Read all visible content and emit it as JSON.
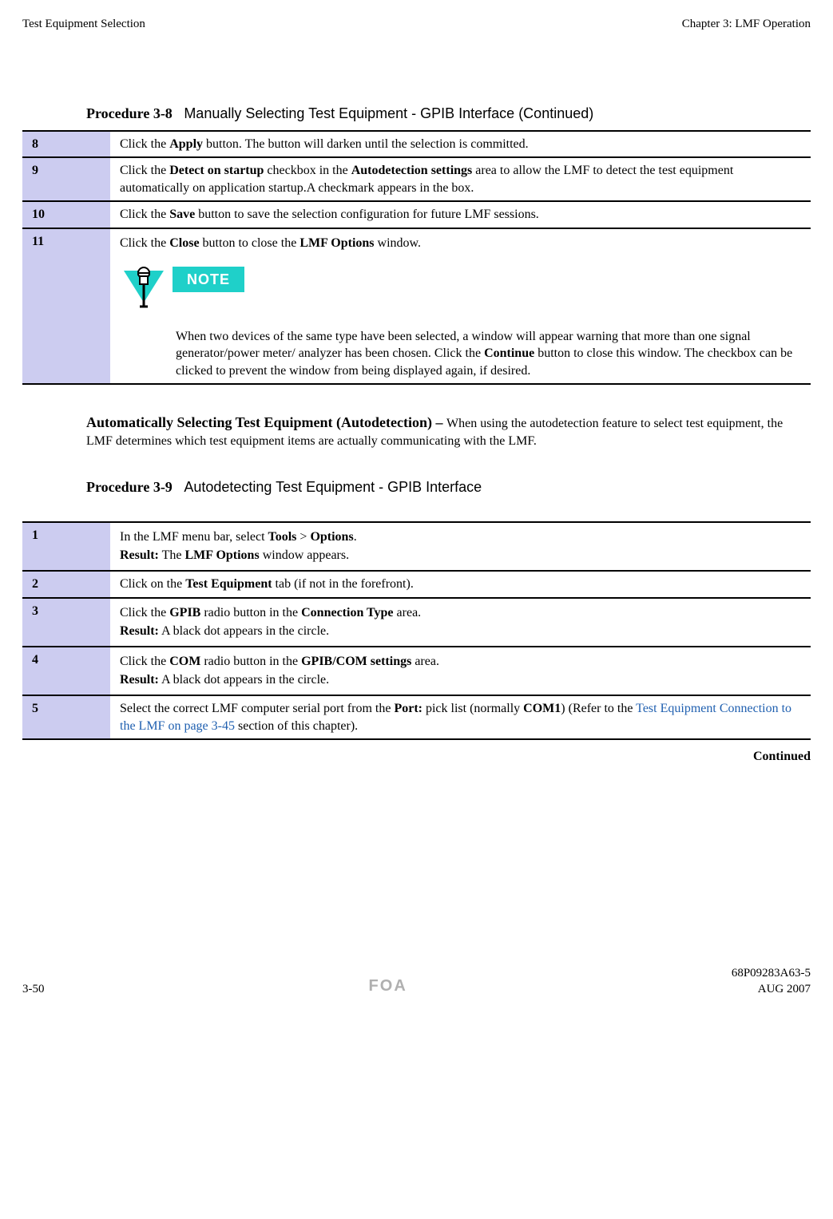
{
  "header": {
    "left": "Test Equipment Selection",
    "right": "Chapter 3: LMF Operation"
  },
  "procedure_3_8": {
    "number": "Procedure 3-8",
    "title": "Manually Selecting Test Equipment - GPIB Interface (Continued)",
    "rows": {
      "r8": {
        "num": "8",
        "t1": "Click the ",
        "b1": "Apply",
        "t2": " button. The button will darken until the selection is committed."
      },
      "r9": {
        "num": "9",
        "t1": "Click the ",
        "b1": "Detect on startup",
        "t2": " checkbox in the ",
        "b2": "Autodetection settings",
        "t3": " area to allow the LMF to detect the test equipment automatically on application startup.A checkmark appears in the box."
      },
      "r10": {
        "num": "10",
        "t1": "Click the ",
        "b1": "Save",
        "t2": " button to save the selection configuration for future LMF sessions."
      },
      "r11": {
        "num": "11",
        "t1": "Click the ",
        "b1": "Close",
        "t2": " button to close the ",
        "b2": "LMF Options",
        "t3": " window.",
        "note_label": "NOTE",
        "note_body_1": "When two devices of the same type have been selected, a window will appear warning that more than one signal generator/power meter/ analyzer has been chosen. Click the ",
        "note_bold": "Continue",
        "note_body_2": " button to close this window. The checkbox can be clicked to prevent the window from being displayed again, if desired."
      }
    }
  },
  "mid_section": {
    "heading": "Automatically Selecting Test Equipment (Autodetection) – ",
    "body": "When using the autodetection feature to select test equipment, the LMF determines which test equipment items are actually communicating with the LMF."
  },
  "procedure_3_9": {
    "number": "Procedure 3-9",
    "title": "Autodetecting Test Equipment - GPIB Interface",
    "rows": {
      "r1": {
        "num": "1",
        "t1": "In the LMF menu bar, select ",
        "b1": "Tools",
        "sep": " > ",
        "b2": "Options",
        "t2": ".",
        "result_label": "Result:",
        "result_t1": " The ",
        "result_b1": "LMF Options",
        "result_t2": " window appears."
      },
      "r2": {
        "num": "2",
        "t1": "Click on the ",
        "b1": "Test Equipment",
        "t2": " tab (if not in the forefront)."
      },
      "r3": {
        "num": "3",
        "t1": "Click the ",
        "b1": "GPIB",
        "t2": " radio button in the ",
        "b2": "Connection Type",
        "t3": " area.",
        "result_label": "Result:",
        "result_t1": " A black dot appears in the circle."
      },
      "r4": {
        "num": "4",
        "t1": "Click the ",
        "b1": "COM",
        "t2": " radio button in the ",
        "b2": "GPIB/COM settings",
        "t3": " area.",
        "result_label": "Result:",
        "result_t1": " A black dot appears in the circle."
      },
      "r5": {
        "num": "5",
        "t1": "Select the correct LMF computer serial port from the ",
        "b1": "Port:",
        "t2": " pick list (normally ",
        "b2": "COM1",
        "t3": ") (Refer to the ",
        "link": "Test Equipment Connection to the LMF on page 3-45",
        "t4": " section of this chapter)."
      }
    },
    "continued": "Continued"
  },
  "footer": {
    "left": "3-50",
    "foa": "FOA",
    "right_top": "68P09283A63-5",
    "right_bottom": "AUG 2007"
  }
}
